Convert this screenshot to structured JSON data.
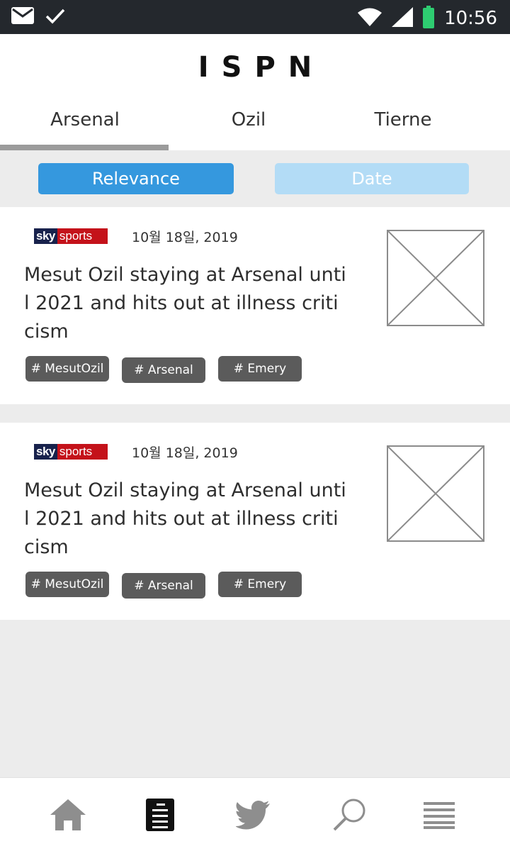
{
  "status_bar": {
    "time": "10:56",
    "icons": [
      "mail-icon",
      "check-icon",
      "wifi-icon",
      "signal-icon",
      "battery-icon"
    ]
  },
  "header": {
    "title": "ISPN"
  },
  "tabs": [
    {
      "label": "Arsenal",
      "selected": true
    },
    {
      "label": "Ozil",
      "selected": false
    },
    {
      "label": "Tierne",
      "selected": false
    }
  ],
  "sort": {
    "relevance_label": "Relevance",
    "date_label": "Date",
    "active": "Relevance"
  },
  "articles": [
    {
      "source_logo": {
        "part1": "sky",
        "part2": "sports"
      },
      "date": "10월 18일, 2019",
      "title": "Mesut Ozil staying at Arsenal until 2021 and hits out at illness criticism",
      "tags": [
        "# MesutOzil",
        "# Arsenal",
        "# Emery"
      ]
    },
    {
      "source_logo": {
        "part1": "sky",
        "part2": "sports"
      },
      "date": "10월 18일, 2019",
      "title": "Mesut Ozil staying at Arsenal until 2021 and hits out at illness criticism",
      "tags": [
        "# MesutOzil",
        "# Arsenal",
        "# Emery"
      ]
    }
  ],
  "bottom_nav": {
    "items": [
      "home-icon",
      "news-icon",
      "twitter-icon",
      "search-icon",
      "menu-icon"
    ],
    "active": "news-icon"
  },
  "colors": {
    "accent": "#3598de",
    "accent_light": "#b3dcf6",
    "tag_bg": "#5b5b5b",
    "status_bar": "#24282d",
    "battery": "#2ecc71"
  }
}
